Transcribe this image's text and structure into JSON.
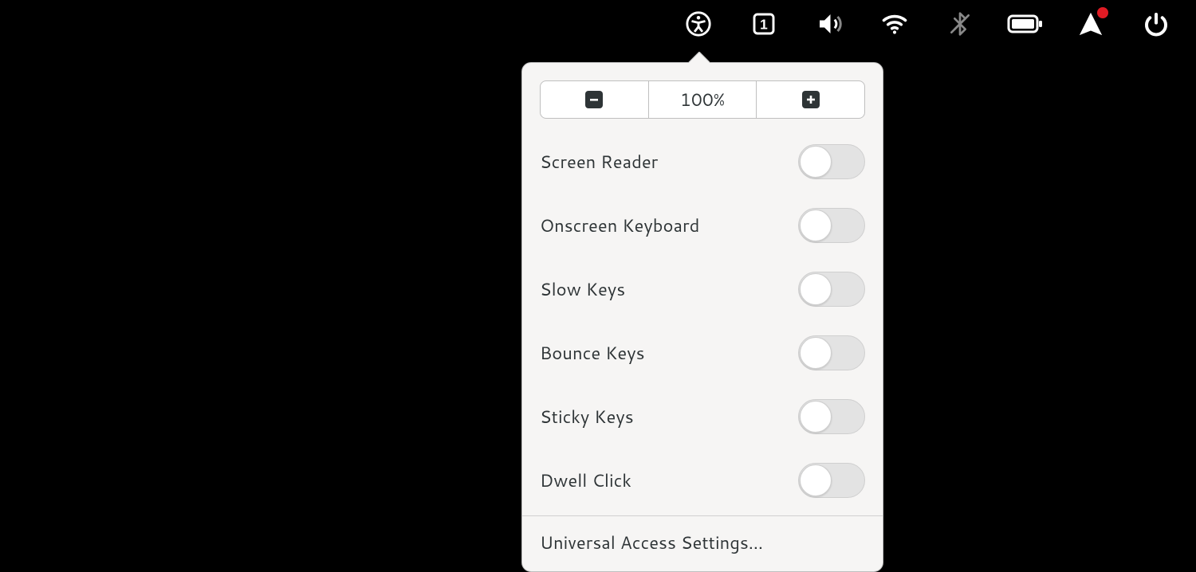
{
  "menubar": {
    "items": [
      {
        "name": "accessibility-icon",
        "active": true
      },
      {
        "name": "keyboard-layout-icon",
        "indicator": "1"
      },
      {
        "name": "volume-icon"
      },
      {
        "name": "wifi-icon"
      },
      {
        "name": "bluetooth-icon",
        "disabled": true
      },
      {
        "name": "battery-icon"
      },
      {
        "name": "notification-alert-icon",
        "badge": true
      },
      {
        "name": "power-icon"
      }
    ]
  },
  "popover": {
    "zoom": {
      "decrease_label": "-",
      "level_label": "100%",
      "increase_label": "+"
    },
    "options": [
      {
        "label": "Screen Reader",
        "on": false
      },
      {
        "label": "Onscreen Keyboard",
        "on": false
      },
      {
        "label": "Slow Keys",
        "on": false
      },
      {
        "label": "Bounce Keys",
        "on": false
      },
      {
        "label": "Sticky Keys",
        "on": false
      },
      {
        "label": "Dwell Click",
        "on": false
      }
    ],
    "footer_label": "Universal Access Settings…"
  }
}
